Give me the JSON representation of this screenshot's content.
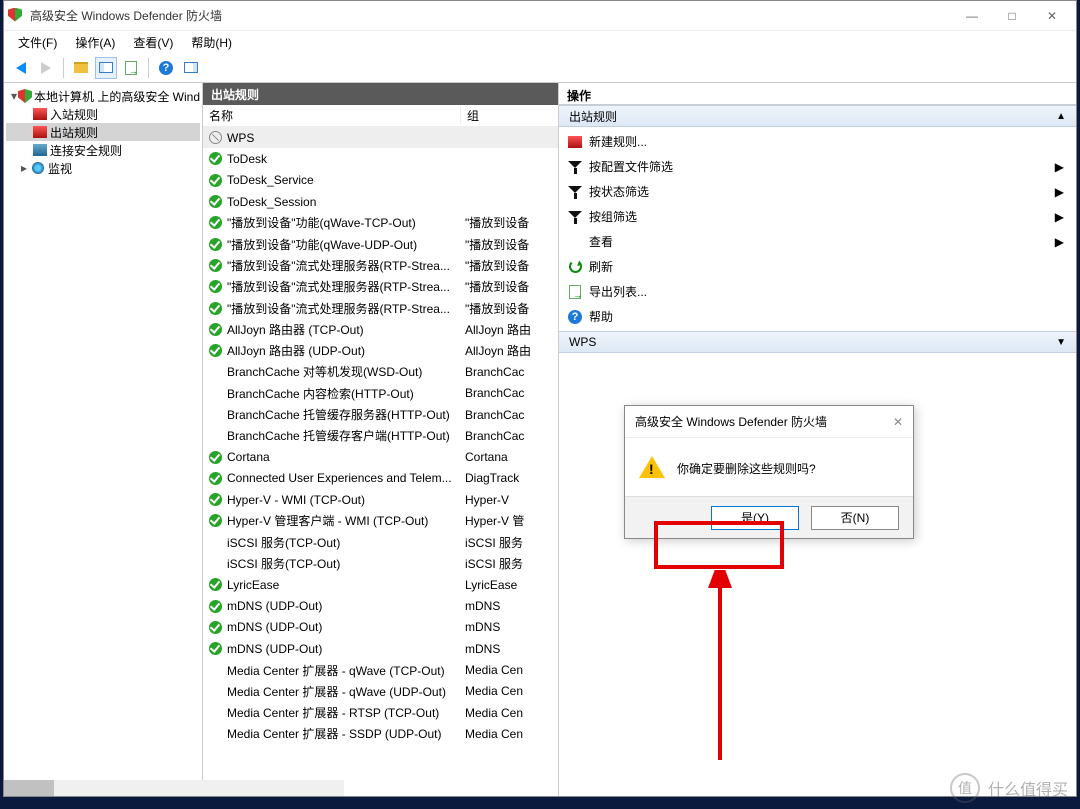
{
  "title": "高级安全 Windows Defender 防火墙",
  "menu": {
    "file": "文件(F)",
    "action": "操作(A)",
    "view": "查看(V)",
    "help": "帮助(H)"
  },
  "tree": {
    "root": "本地计算机 上的高级安全 Wind",
    "inbound": "入站规则",
    "outbound": "出站规则",
    "consec": "连接安全规则",
    "monitor": "监视"
  },
  "mid_header": "出站规则",
  "cols": {
    "name": "名称",
    "group": "组"
  },
  "rules": [
    {
      "icon": "block",
      "name": "WPS",
      "group": "",
      "sel": true
    },
    {
      "icon": "check",
      "name": "ToDesk",
      "group": ""
    },
    {
      "icon": "check",
      "name": "ToDesk_Service",
      "group": ""
    },
    {
      "icon": "check",
      "name": "ToDesk_Session",
      "group": ""
    },
    {
      "icon": "check",
      "name": "\"播放到设备\"功能(qWave-TCP-Out)",
      "group": "\"播放到设备"
    },
    {
      "icon": "check",
      "name": "\"播放到设备\"功能(qWave-UDP-Out)",
      "group": "\"播放到设备"
    },
    {
      "icon": "check",
      "name": "\"播放到设备\"流式处理服务器(RTP-Strea...",
      "group": "\"播放到设备"
    },
    {
      "icon": "check",
      "name": "\"播放到设备\"流式处理服务器(RTP-Strea...",
      "group": "\"播放到设备"
    },
    {
      "icon": "check",
      "name": "\"播放到设备\"流式处理服务器(RTP-Strea...",
      "group": "\"播放到设备"
    },
    {
      "icon": "check",
      "name": "AllJoyn 路由器 (TCP-Out)",
      "group": "AllJoyn 路由"
    },
    {
      "icon": "check",
      "name": "AllJoyn 路由器 (UDP-Out)",
      "group": "AllJoyn 路由"
    },
    {
      "icon": "none",
      "name": "BranchCache 对等机发现(WSD-Out)",
      "group": "BranchCac"
    },
    {
      "icon": "none",
      "name": "BranchCache 内容检索(HTTP-Out)",
      "group": "BranchCac"
    },
    {
      "icon": "none",
      "name": "BranchCache 托管缓存服务器(HTTP-Out)",
      "group": "BranchCac"
    },
    {
      "icon": "none",
      "name": "BranchCache 托管缓存客户端(HTTP-Out)",
      "group": "BranchCac"
    },
    {
      "icon": "check",
      "name": "Cortana",
      "group": "Cortana"
    },
    {
      "icon": "check",
      "name": "Connected User Experiences and Telem...",
      "group": "DiagTrack"
    },
    {
      "icon": "check",
      "name": "Hyper-V - WMI (TCP-Out)",
      "group": "Hyper-V"
    },
    {
      "icon": "check",
      "name": "Hyper-V 管理客户端 - WMI (TCP-Out)",
      "group": "Hyper-V 管"
    },
    {
      "icon": "none",
      "name": "iSCSI 服务(TCP-Out)",
      "group": "iSCSI 服务"
    },
    {
      "icon": "none",
      "name": "iSCSI 服务(TCP-Out)",
      "group": "iSCSI 服务"
    },
    {
      "icon": "check",
      "name": "LyricEase",
      "group": "LyricEase"
    },
    {
      "icon": "check",
      "name": "mDNS (UDP-Out)",
      "group": "mDNS"
    },
    {
      "icon": "check",
      "name": "mDNS (UDP-Out)",
      "group": "mDNS"
    },
    {
      "icon": "check",
      "name": "mDNS (UDP-Out)",
      "group": "mDNS"
    },
    {
      "icon": "none",
      "name": "Media Center 扩展器 - qWave (TCP-Out)",
      "group": "Media Cen"
    },
    {
      "icon": "none",
      "name": "Media Center 扩展器 - qWave (UDP-Out)",
      "group": "Media Cen"
    },
    {
      "icon": "none",
      "name": "Media Center 扩展器 - RTSP (TCP-Out)",
      "group": "Media Cen"
    },
    {
      "icon": "none",
      "name": "Media Center 扩展器 - SSDP (UDP-Out)",
      "group": "Media Cen"
    }
  ],
  "right": {
    "header": "操作",
    "section1": "出站规则",
    "new_rule": "新建规则...",
    "by_profile": "按配置文件筛选",
    "by_state": "按状态筛选",
    "by_group": "按组筛选",
    "view": "查看",
    "refresh": "刷新",
    "export": "导出列表...",
    "help": "帮助",
    "section2": "WPS"
  },
  "dialog": {
    "title": "高级安全 Windows Defender 防火墙",
    "msg": "你确定要删除这些规则吗?",
    "yes": "是(Y)",
    "no": "否(N)"
  },
  "watermark": "什么值得买"
}
